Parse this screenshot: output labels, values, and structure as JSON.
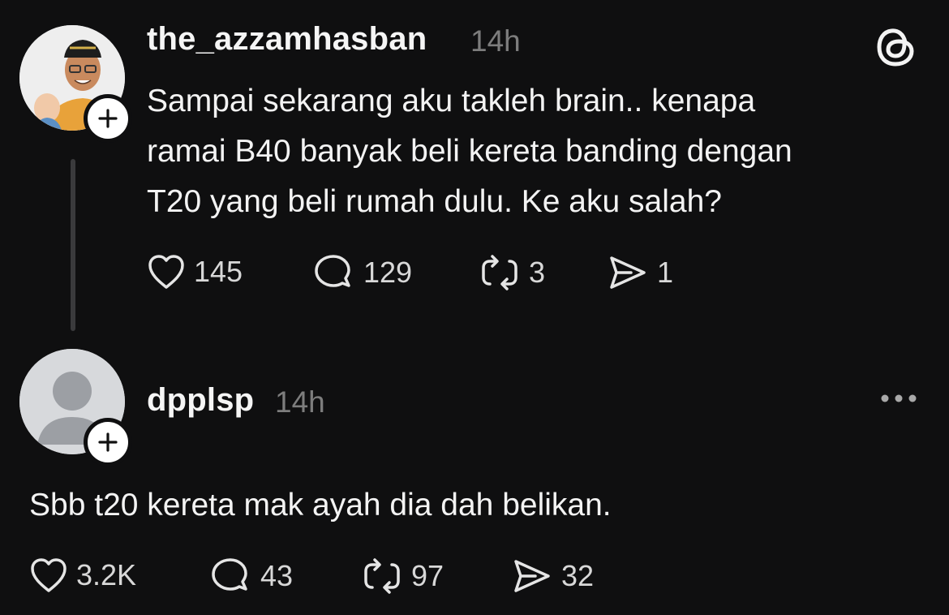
{
  "post": {
    "username": "the_azzamhasban",
    "time": "14h",
    "lines": [
      "Sampai sekarang aku takleh brain.. kenapa",
      "ramai B40 banyak beli kereta banding dengan",
      "T20 yang beli rumah dulu. Ke aku salah?"
    ],
    "likes": "145",
    "comments": "129",
    "reposts": "3",
    "shares": "1"
  },
  "reply": {
    "username": "dpplsp",
    "time": "14h",
    "text": "Sbb t20 kereta mak ayah dia dah belikan.",
    "likes": "3.2K",
    "comments": "43",
    "reposts": "97",
    "shares": "32"
  },
  "icons": {
    "app_logo": "threads-logo-icon",
    "more": "more-options-icon",
    "like": "heart-icon",
    "comment": "comment-bubble-icon",
    "repost": "repost-icon",
    "share": "share-send-icon",
    "follow": "plus-icon"
  }
}
